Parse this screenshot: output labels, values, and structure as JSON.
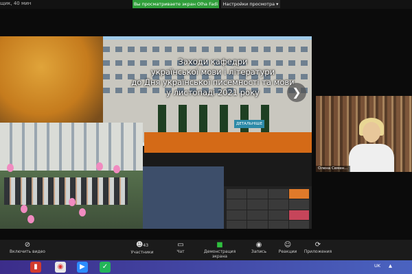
{
  "top_bar": {
    "recording_time": "щик, 40 мин",
    "share_banner": "Вы просматриваете экран Olha Fadi",
    "view_settings": "Настройки просмотра"
  },
  "slide": {
    "title_lines": [
      "Заходи кафедри",
      "української мови і літератури",
      "до Дня української писемності та мови",
      "у листопаді 2021 року"
    ],
    "more_button": "ДЕТАЛЬНІШЕ",
    "next_arrow": "❯"
  },
  "speaker": {
    "name": "Олена Семен..."
  },
  "toolbar": {
    "video": "Включить видео",
    "participants": "Участники",
    "participants_count": "43",
    "chat": "Чат",
    "share": "Демонстрация экрана",
    "record": "Запись",
    "reactions": "Реакции",
    "apps": "Приложения"
  },
  "taskbar": {
    "lang": "UK"
  },
  "icons": {
    "video": "video-off-icon",
    "participants": "people-icon",
    "chat": "chat-icon",
    "share": "share-screen-icon",
    "record": "record-icon",
    "reactions": "emoji-icon",
    "apps": "apps-icon"
  }
}
